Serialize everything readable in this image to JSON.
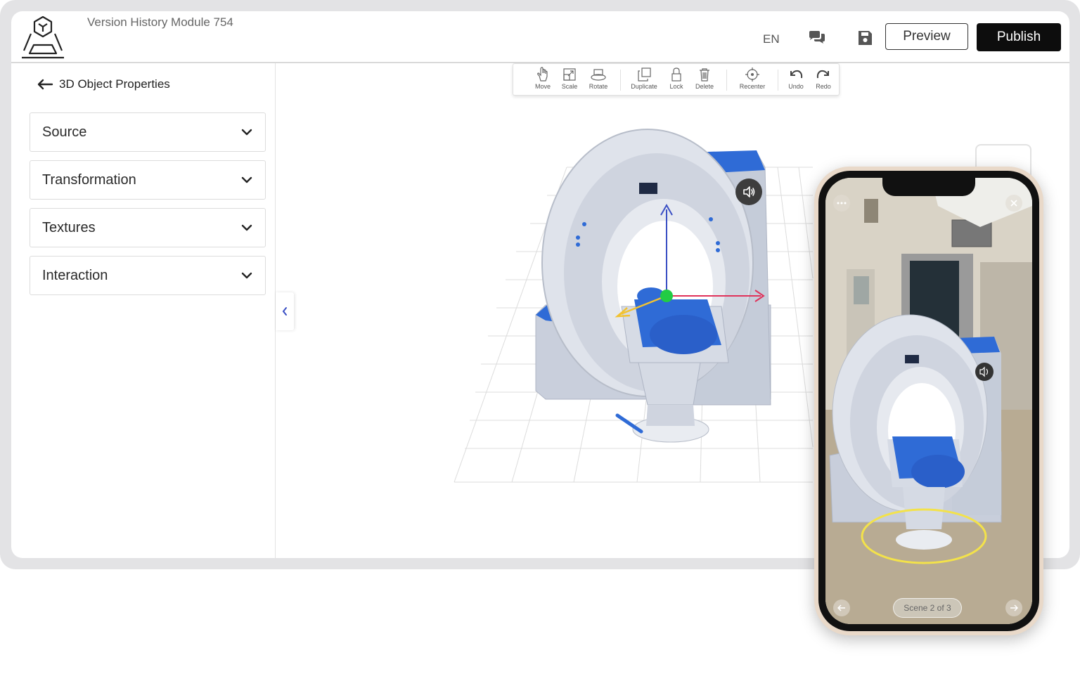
{
  "header": {
    "module_title": "Version History Module 754",
    "language": "EN",
    "preview_label": "Preview",
    "publish_label": "Publish"
  },
  "sidebar": {
    "back_title": "3D Object Properties",
    "sections": [
      {
        "label": "Source"
      },
      {
        "label": "Transformation"
      },
      {
        "label": "Textures"
      },
      {
        "label": "Interaction"
      }
    ]
  },
  "toolbar": {
    "tools": [
      {
        "label": "Move",
        "icon": "hand-icon"
      },
      {
        "label": "Scale",
        "icon": "scale-icon"
      },
      {
        "label": "Rotate",
        "icon": "rotate-icon"
      },
      {
        "label": "Duplicate",
        "icon": "duplicate-icon"
      },
      {
        "label": "Lock",
        "icon": "lock-icon"
      },
      {
        "label": "Delete",
        "icon": "trash-icon"
      },
      {
        "label": "Recenter",
        "icon": "recenter-icon"
      },
      {
        "label": "Undo",
        "icon": "undo-icon"
      },
      {
        "label": "Redo",
        "icon": "redo-icon"
      }
    ]
  },
  "phone": {
    "scene_label": "Scene 2 of 3"
  },
  "colors": {
    "publish_bg": "#0d0d0d",
    "model_blue": "#2f6bd6",
    "axis_x": "#e0325a",
    "axis_y": "#3a4fc4",
    "axis_z": "#f1c232",
    "gizmo_center": "#22cc44"
  }
}
